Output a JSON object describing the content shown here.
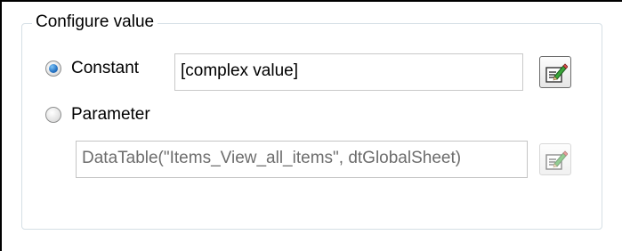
{
  "group": {
    "title": "Configure value"
  },
  "constant": {
    "label": "Constant",
    "selected": true,
    "value": "[complex value]",
    "edit_button": "edit-value-icon"
  },
  "parameter": {
    "label": "Parameter",
    "selected": false,
    "value": "DataTable(\"Items_View_all_items\", dtGlobalSheet)",
    "enabled": false,
    "edit_button": "edit-value-icon"
  },
  "colors": {
    "radio_selected": "#2a78c8",
    "groupbox_border": "#d5dfe5",
    "disabled_text": "#6d6d6d"
  }
}
